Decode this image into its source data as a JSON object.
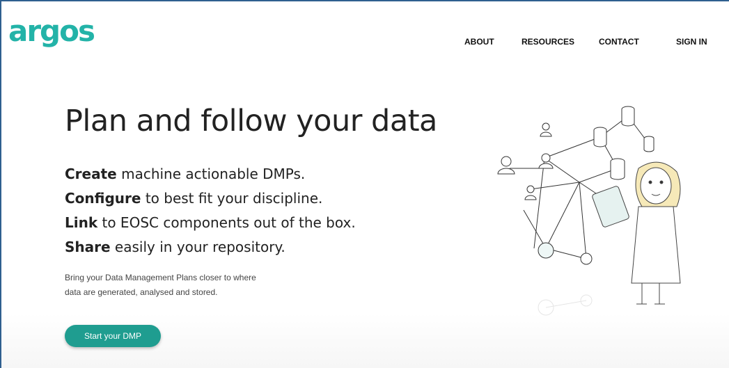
{
  "brand": {
    "logo_text": "argos",
    "accent_color": "#23b3a8",
    "button_color": "#1f9d90"
  },
  "nav": {
    "items": [
      {
        "label": "ABOUT"
      },
      {
        "label": "RESOURCES"
      },
      {
        "label": "CONTACT"
      },
      {
        "label": "SIGN IN"
      }
    ]
  },
  "hero": {
    "headline": "Plan and follow your data",
    "features": [
      {
        "keyword": "Create",
        "rest": " machine actionable DMPs."
      },
      {
        "keyword": "Configure",
        "rest": " to best fit your discipline."
      },
      {
        "keyword": "Link",
        "rest": " to EOSC components out of the box."
      },
      {
        "keyword": "Share",
        "rest": " easily in your repository."
      }
    ],
    "description_line1": "Bring your Data Management Plans closer to where",
    "description_line2": "data are generated, analysed and stored.",
    "cta_label": "Start your DMP"
  },
  "illustration": {
    "icon": "network-researcher-illustration"
  }
}
